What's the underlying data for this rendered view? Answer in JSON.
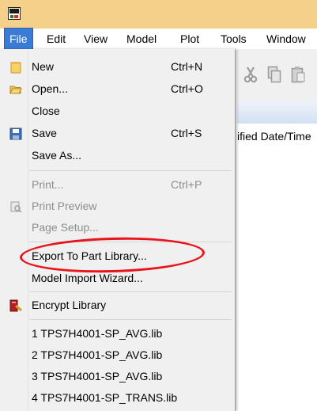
{
  "menubar": {
    "items": [
      {
        "label": "File",
        "active": true
      },
      {
        "label": "Edit"
      },
      {
        "label": "View"
      },
      {
        "label": "Model"
      },
      {
        "label": "Plot"
      },
      {
        "label": "Tools"
      },
      {
        "label": "Window"
      }
    ]
  },
  "background": {
    "column_header": "ified Date/Time"
  },
  "file_menu": {
    "items": [
      {
        "label": "New",
        "shortcut": "Ctrl+N",
        "icon": "new-file-icon",
        "enabled": true
      },
      {
        "label": "Open...",
        "shortcut": "Ctrl+O",
        "icon": "folder-open-icon",
        "enabled": true
      },
      {
        "label": "Close",
        "enabled": true
      },
      {
        "label": "Save",
        "shortcut": "Ctrl+S",
        "icon": "save-disk-icon",
        "enabled": true
      },
      {
        "label": "Save As...",
        "enabled": true
      },
      {
        "label": "Print...",
        "shortcut": "Ctrl+P",
        "enabled": false
      },
      {
        "label": "Print Preview",
        "icon": "print-preview-icon",
        "enabled": false
      },
      {
        "label": "Page Setup...",
        "enabled": false
      },
      {
        "label": "Export To Part Library...",
        "enabled": true,
        "highlighted_by_annotation": true
      },
      {
        "label": "Model Import Wizard...",
        "enabled": true
      },
      {
        "label": "Encrypt Library",
        "icon": "encrypt-library-icon",
        "enabled": true
      },
      {
        "label": "1 TPS7H4001-SP_AVG.lib",
        "enabled": true
      },
      {
        "label": "2 TPS7H4001-SP_AVG.lib",
        "enabled": true
      },
      {
        "label": "3 TPS7H4001-SP_AVG.lib",
        "enabled": true
      },
      {
        "label": "4 TPS7H4001-SP_TRANS.lib",
        "enabled": true
      }
    ]
  },
  "colors": {
    "title_bar": "#f5d08a",
    "menu_active": "#3a7bd5",
    "menu_background": "#f0f0f0",
    "disabled_text": "#8d8d8d",
    "annotation_ellipse": "#e8141c"
  }
}
